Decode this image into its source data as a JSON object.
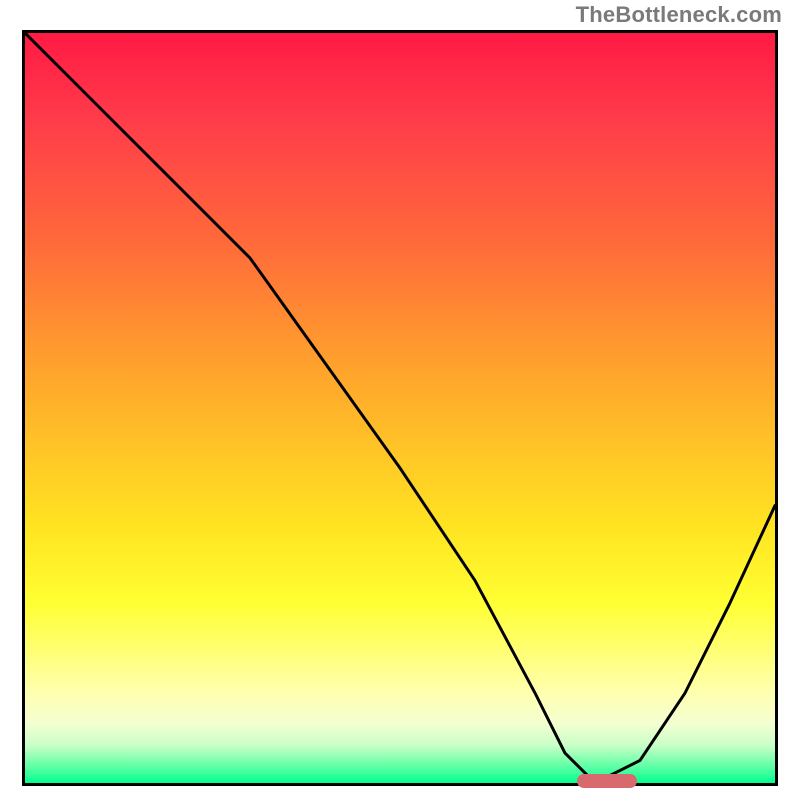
{
  "watermark": "TheBottleneck.com",
  "chart_data": {
    "type": "line",
    "title": "",
    "xlabel": "",
    "ylabel": "",
    "xlim": [
      0,
      100
    ],
    "ylim": [
      0,
      100
    ],
    "grid": false,
    "legend": false,
    "gradient_background": {
      "top": "#ff1a44",
      "bottom": "#00ff88",
      "note": "vertical red→orange→yellow→green gradient"
    },
    "series": [
      {
        "name": "curve",
        "x": [
          0,
          10,
          22,
          30,
          40,
          50,
          60,
          68,
          72,
          75,
          78,
          82,
          88,
          94,
          100
        ],
        "values": [
          100,
          90,
          78,
          70,
          56,
          42,
          27,
          12,
          4,
          1,
          1,
          3,
          12,
          24,
          37
        ]
      }
    ],
    "marker": {
      "x_start": 73,
      "x_end": 81,
      "y": 1,
      "color": "#d86a6f",
      "shape": "rounded-bar"
    }
  }
}
